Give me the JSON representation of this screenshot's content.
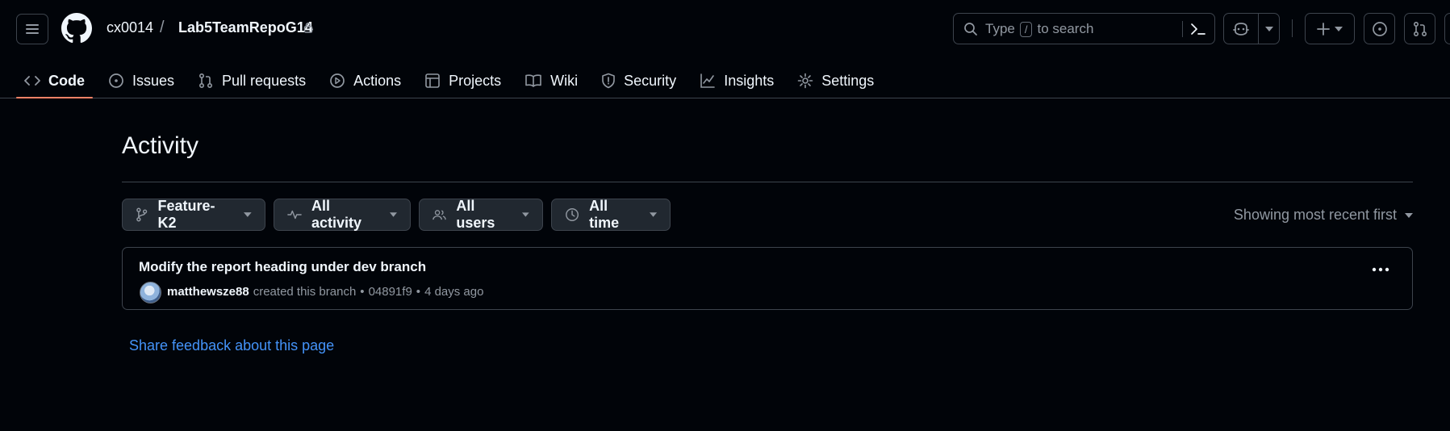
{
  "header": {
    "owner": "cx0014",
    "separator": "/",
    "repo": "Lab5TeamRepoG14",
    "search": {
      "prefix": "Type",
      "key": "/",
      "suffix": "to search"
    }
  },
  "tabs": [
    {
      "label": "Code",
      "icon": "code-icon",
      "active": true
    },
    {
      "label": "Issues",
      "icon": "issue-icon"
    },
    {
      "label": "Pull requests",
      "icon": "pull-request-icon"
    },
    {
      "label": "Actions",
      "icon": "play-icon"
    },
    {
      "label": "Projects",
      "icon": "table-icon"
    },
    {
      "label": "Wiki",
      "icon": "book-icon"
    },
    {
      "label": "Security",
      "icon": "shield-icon"
    },
    {
      "label": "Insights",
      "icon": "graph-icon"
    },
    {
      "label": "Settings",
      "icon": "gear-icon"
    }
  ],
  "page": {
    "title": "Activity",
    "filters": {
      "branch": "Feature-K2",
      "activity": "All activity",
      "users": "All users",
      "time": "All time"
    },
    "sort": "Showing most recent first"
  },
  "activity": [
    {
      "title": "Modify the report heading under dev branch",
      "user": "matthewsze88",
      "action": "created this branch",
      "bullet": "•",
      "sha": "04891f9",
      "time": "4 days ago"
    }
  ],
  "feedback": "Share feedback about this page",
  "colors": {
    "background": "#010409",
    "border": "#3d444d",
    "text": "#f0f6fc",
    "muted": "#9198a1",
    "link": "#4493f8",
    "active_tab_underline": "#f78166",
    "button_bg": "#212830"
  }
}
